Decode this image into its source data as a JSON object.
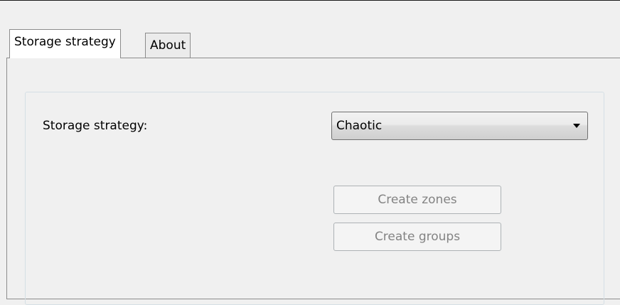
{
  "tabs": [
    {
      "label": "Storage strategy",
      "active": true
    },
    {
      "label": "About",
      "active": false
    }
  ],
  "form": {
    "strategy_label": "Storage strategy:",
    "strategy_value": "Chaotic"
  },
  "buttons": {
    "create_zones": "Create zones",
    "create_groups": "Create groups",
    "disabled": true
  }
}
